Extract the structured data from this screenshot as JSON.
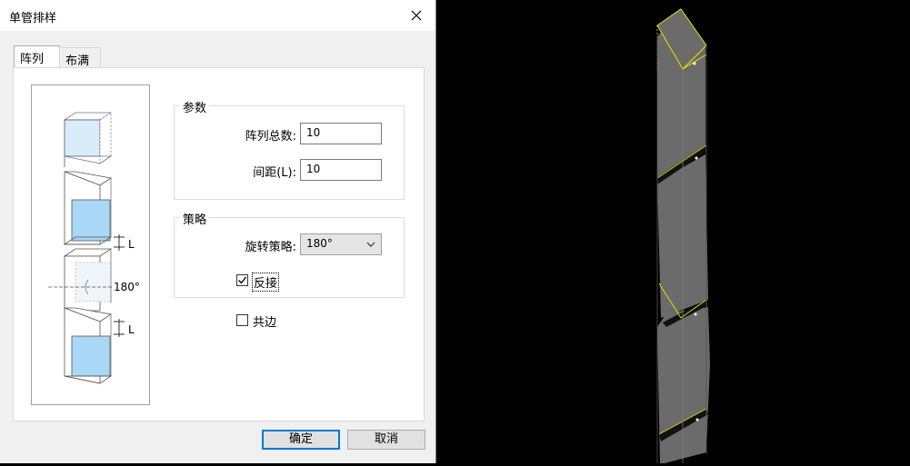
{
  "dialog": {
    "title": "单管排样",
    "tabs": [
      {
        "label": "阵列",
        "active": true
      },
      {
        "label": "布满",
        "active": false
      }
    ],
    "preview": {
      "dim_label_top": "L",
      "rotation_label": "180°",
      "dim_label_bottom": "L"
    },
    "params": {
      "group_label": "参数",
      "array_count_label": "阵列总数:",
      "array_count_value": "10",
      "spacing_label": "间距(L):",
      "spacing_value": "10"
    },
    "strategy": {
      "group_label": "策略",
      "rotate_label": "旋转策略:",
      "rotate_value": "180°",
      "reverse_label": "反接",
      "reverse_checked": true
    },
    "common_edge_label": "共边",
    "common_edge_checked": false,
    "ok_label": "确定",
    "cancel_label": "取消"
  },
  "colors": {
    "dialog_bg": "#f0f0f0",
    "viewport_bg": "#000000",
    "pipe_fill": "#6b6b6b",
    "pipe_highlight": "#e6e600",
    "preview_fill": "#a8d8f5"
  }
}
